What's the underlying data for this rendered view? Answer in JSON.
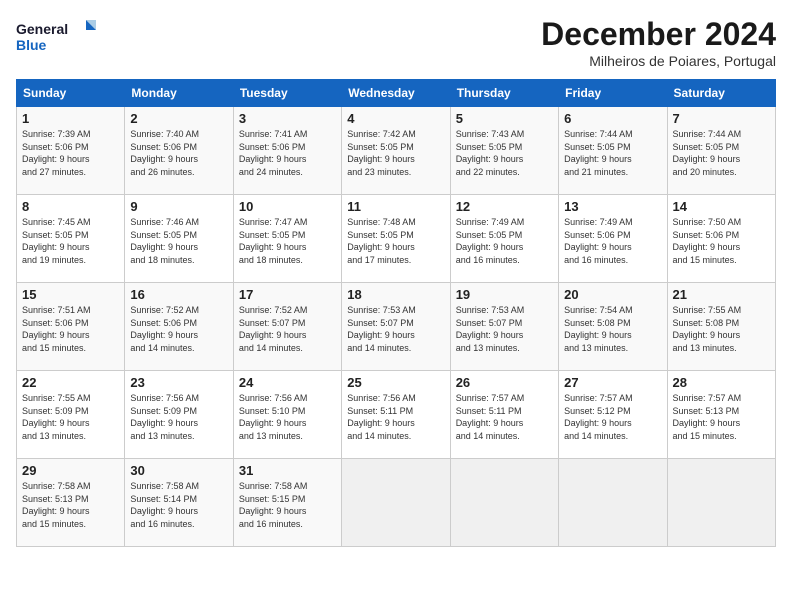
{
  "logo": {
    "line1": "General",
    "line2": "Blue"
  },
  "title": "December 2024",
  "subtitle": "Milheiros de Poiares, Portugal",
  "weekdays": [
    "Sunday",
    "Monday",
    "Tuesday",
    "Wednesday",
    "Thursday",
    "Friday",
    "Saturday"
  ],
  "weeks": [
    [
      {
        "day": "1",
        "sunrise": "7:39 AM",
        "sunset": "5:06 PM",
        "daylight_hours": "9",
        "daylight_minutes": "27"
      },
      {
        "day": "2",
        "sunrise": "7:40 AM",
        "sunset": "5:06 PM",
        "daylight_hours": "9",
        "daylight_minutes": "26"
      },
      {
        "day": "3",
        "sunrise": "7:41 AM",
        "sunset": "5:06 PM",
        "daylight_hours": "9",
        "daylight_minutes": "24"
      },
      {
        "day": "4",
        "sunrise": "7:42 AM",
        "sunset": "5:05 PM",
        "daylight_hours": "9",
        "daylight_minutes": "23"
      },
      {
        "day": "5",
        "sunrise": "7:43 AM",
        "sunset": "5:05 PM",
        "daylight_hours": "9",
        "daylight_minutes": "22"
      },
      {
        "day": "6",
        "sunrise": "7:44 AM",
        "sunset": "5:05 PM",
        "daylight_hours": "9",
        "daylight_minutes": "21"
      },
      {
        "day": "7",
        "sunrise": "7:44 AM",
        "sunset": "5:05 PM",
        "daylight_hours": "9",
        "daylight_minutes": "20"
      }
    ],
    [
      {
        "day": "8",
        "sunrise": "7:45 AM",
        "sunset": "5:05 PM",
        "daylight_hours": "9",
        "daylight_minutes": "19"
      },
      {
        "day": "9",
        "sunrise": "7:46 AM",
        "sunset": "5:05 PM",
        "daylight_hours": "9",
        "daylight_minutes": "18"
      },
      {
        "day": "10",
        "sunrise": "7:47 AM",
        "sunset": "5:05 PM",
        "daylight_hours": "9",
        "daylight_minutes": "18"
      },
      {
        "day": "11",
        "sunrise": "7:48 AM",
        "sunset": "5:05 PM",
        "daylight_hours": "9",
        "daylight_minutes": "17"
      },
      {
        "day": "12",
        "sunrise": "7:49 AM",
        "sunset": "5:05 PM",
        "daylight_hours": "9",
        "daylight_minutes": "16"
      },
      {
        "day": "13",
        "sunrise": "7:49 AM",
        "sunset": "5:06 PM",
        "daylight_hours": "9",
        "daylight_minutes": "16"
      },
      {
        "day": "14",
        "sunrise": "7:50 AM",
        "sunset": "5:06 PM",
        "daylight_hours": "9",
        "daylight_minutes": "15"
      }
    ],
    [
      {
        "day": "15",
        "sunrise": "7:51 AM",
        "sunset": "5:06 PM",
        "daylight_hours": "9",
        "daylight_minutes": "15"
      },
      {
        "day": "16",
        "sunrise": "7:52 AM",
        "sunset": "5:06 PM",
        "daylight_hours": "9",
        "daylight_minutes": "14"
      },
      {
        "day": "17",
        "sunrise": "7:52 AM",
        "sunset": "5:07 PM",
        "daylight_hours": "9",
        "daylight_minutes": "14"
      },
      {
        "day": "18",
        "sunrise": "7:53 AM",
        "sunset": "5:07 PM",
        "daylight_hours": "9",
        "daylight_minutes": "14"
      },
      {
        "day": "19",
        "sunrise": "7:53 AM",
        "sunset": "5:07 PM",
        "daylight_hours": "9",
        "daylight_minutes": "13"
      },
      {
        "day": "20",
        "sunrise": "7:54 AM",
        "sunset": "5:08 PM",
        "daylight_hours": "9",
        "daylight_minutes": "13"
      },
      {
        "day": "21",
        "sunrise": "7:55 AM",
        "sunset": "5:08 PM",
        "daylight_hours": "9",
        "daylight_minutes": "13"
      }
    ],
    [
      {
        "day": "22",
        "sunrise": "7:55 AM",
        "sunset": "5:09 PM",
        "daylight_hours": "9",
        "daylight_minutes": "13"
      },
      {
        "day": "23",
        "sunrise": "7:56 AM",
        "sunset": "5:09 PM",
        "daylight_hours": "9",
        "daylight_minutes": "13"
      },
      {
        "day": "24",
        "sunrise": "7:56 AM",
        "sunset": "5:10 PM",
        "daylight_hours": "9",
        "daylight_minutes": "13"
      },
      {
        "day": "25",
        "sunrise": "7:56 AM",
        "sunset": "5:11 PM",
        "daylight_hours": "9",
        "daylight_minutes": "14"
      },
      {
        "day": "26",
        "sunrise": "7:57 AM",
        "sunset": "5:11 PM",
        "daylight_hours": "9",
        "daylight_minutes": "14"
      },
      {
        "day": "27",
        "sunrise": "7:57 AM",
        "sunset": "5:12 PM",
        "daylight_hours": "9",
        "daylight_minutes": "14"
      },
      {
        "day": "28",
        "sunrise": "7:57 AM",
        "sunset": "5:13 PM",
        "daylight_hours": "9",
        "daylight_minutes": "15"
      }
    ],
    [
      {
        "day": "29",
        "sunrise": "7:58 AM",
        "sunset": "5:13 PM",
        "daylight_hours": "9",
        "daylight_minutes": "15"
      },
      {
        "day": "30",
        "sunrise": "7:58 AM",
        "sunset": "5:14 PM",
        "daylight_hours": "9",
        "daylight_minutes": "16"
      },
      {
        "day": "31",
        "sunrise": "7:58 AM",
        "sunset": "5:15 PM",
        "daylight_hours": "9",
        "daylight_minutes": "16"
      },
      null,
      null,
      null,
      null
    ]
  ],
  "labels": {
    "sunrise": "Sunrise:",
    "sunset": "Sunset:",
    "daylight": "Daylight:"
  }
}
